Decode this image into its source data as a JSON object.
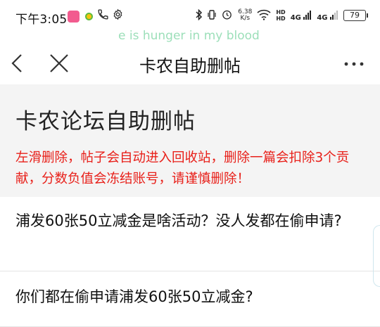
{
  "status_bar": {
    "time": "下午3:05",
    "net_speed_value": "6.38",
    "net_speed_unit": "K/s",
    "hd1": "HD",
    "hd2": "HD",
    "sig1": "4G",
    "sig2": "4G",
    "battery": "79"
  },
  "lyric": "e is hunger in my blood",
  "nav": {
    "title": "卡农自助删帖"
  },
  "header": {
    "forum_title": "卡农论坛自助删帖",
    "warning": "左滑删除，帖子会自动进入回收站，删除一篇会扣除3个贡献，分数负值会冻结账号，请谨慎删除！"
  },
  "posts": [
    {
      "title": "浦发60张50立减金是啥活动？没人发都在偷申请?"
    },
    {
      "title": "你们都在偷申请浦发60张50立减金?"
    }
  ],
  "colors": {
    "warning": "#e8201a",
    "header_bg": "#f4f4f4",
    "lyric": "#9cdfb9"
  }
}
